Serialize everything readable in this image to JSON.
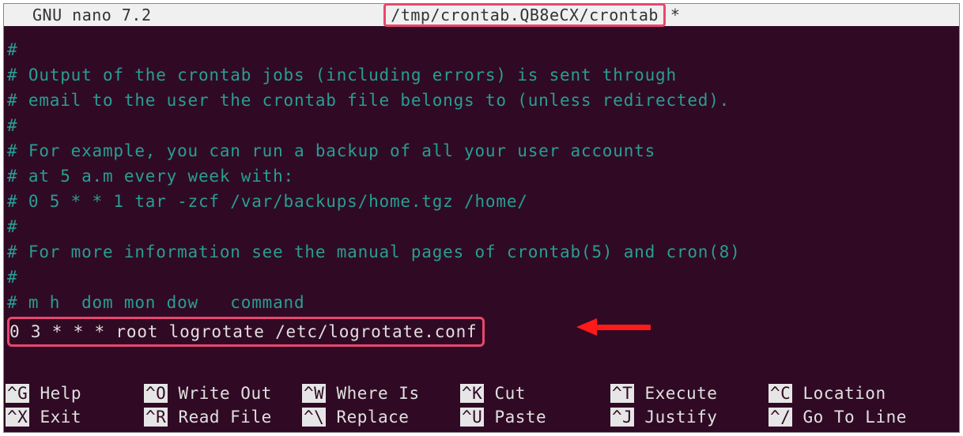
{
  "titlebar": {
    "app": "GNU nano 7.2",
    "file": "/tmp/crontab.QB8eCX/crontab",
    "modified": " *"
  },
  "content": {
    "lines": [
      "#",
      "# Output of the crontab jobs (including errors) is sent through",
      "# email to the user the crontab file belongs to (unless redirected).",
      "#",
      "# For example, you can run a backup of all your user accounts",
      "# at 5 a.m every week with:",
      "# 0 5 * * 1 tar -zcf /var/backups/home.tgz /home/",
      "#",
      "# For more information see the manual pages of crontab(5) and cron(8)",
      "#",
      "# m h  dom mon dow   command"
    ],
    "cron_entry": "0 3 * * * root logrotate /etc/logrotate.conf"
  },
  "menu": {
    "row1": [
      {
        "key": "^G",
        "label": " Help"
      },
      {
        "key": "^O",
        "label": " Write Out"
      },
      {
        "key": "^W",
        "label": " Where Is"
      },
      {
        "key": "^K",
        "label": " Cut"
      },
      {
        "key": "^T",
        "label": " Execute"
      },
      {
        "key": "^C",
        "label": " Location"
      }
    ],
    "row2": [
      {
        "key": "^X",
        "label": " Exit"
      },
      {
        "key": "^R",
        "label": " Read File"
      },
      {
        "key": "^\\",
        "label": " Replace"
      },
      {
        "key": "^U",
        "label": " Paste"
      },
      {
        "key": "^J",
        "label": " Justify"
      },
      {
        "key": "^/",
        "label": " Go To Line"
      }
    ]
  }
}
